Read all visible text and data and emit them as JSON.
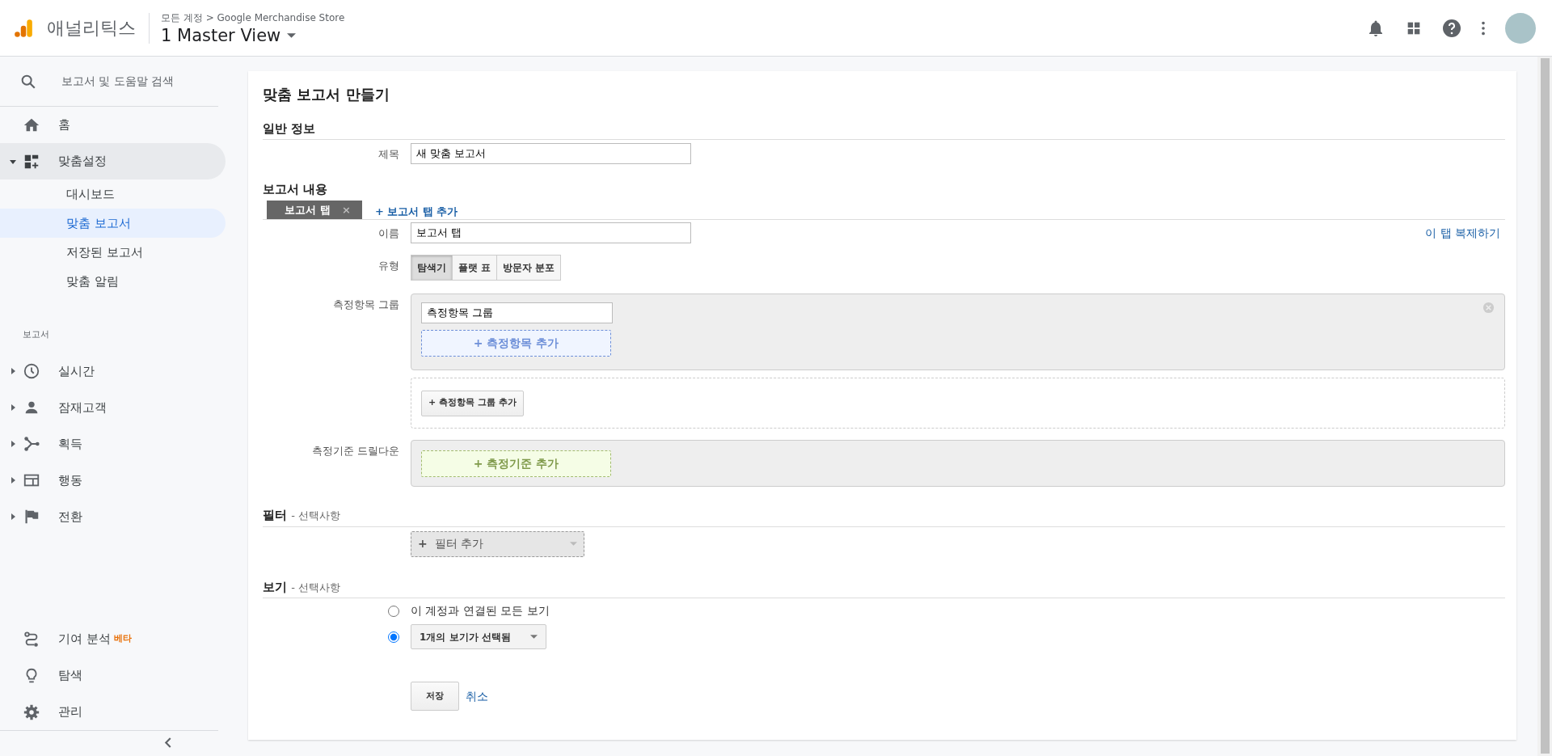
{
  "header": {
    "product": "애널리틱스",
    "breadcrumb": "모든 계정 > Google Merchandise Store",
    "view": "1 Master View"
  },
  "sidebar": {
    "search_placeholder": "보고서 및 도움말 검색",
    "top_items": [
      {
        "label": "홈",
        "selected": false
      },
      {
        "label": "맞춤설정",
        "selected": true,
        "expanded": true,
        "children": [
          {
            "label": "대시보드",
            "selected": false
          },
          {
            "label": "맞춤 보고서",
            "selected": true
          },
          {
            "label": "저장된 보고서",
            "selected": false
          },
          {
            "label": "맞춤 알림",
            "selected": false
          }
        ]
      }
    ],
    "section_label": "보고서",
    "report_items": [
      {
        "label": "실시간",
        "expanded": false
      },
      {
        "label": "잠재고객",
        "expanded": false
      },
      {
        "label": "획득",
        "expanded": false
      },
      {
        "label": "행동",
        "expanded": false
      },
      {
        "label": "전환",
        "expanded": false
      }
    ],
    "bottom_items": [
      {
        "label": "기여 분석",
        "badge": "베타"
      },
      {
        "label": "탐색"
      },
      {
        "label": "관리"
      }
    ]
  },
  "form": {
    "title": "맞춤 보고서 만들기",
    "general": {
      "heading": "일반 정보",
      "title_label": "제목",
      "title_value": "새 맞춤 보고서"
    },
    "content": {
      "heading": "보고서 내용",
      "tabs": [
        {
          "label": "보고서 탭",
          "close": "×",
          "selected": true
        }
      ],
      "add_tab": "+ 보고서 탭 추가",
      "duplicate": "이 탭 복제하기",
      "name_label": "이름",
      "name_value": "보고서 탭",
      "type_label": "유형",
      "types": [
        {
          "label": "탐색기",
          "selected": true
        },
        {
          "label": "플랫 표",
          "selected": false
        },
        {
          "label": "방문자 분포",
          "selected": false
        }
      ],
      "metric_group_label": "측정항목 그룹",
      "metric_groups": [
        {
          "name": "측정항목 그룹",
          "add_metric": "+ 측정항목 추가"
        }
      ],
      "add_metric_group": "+ 측정항목 그룹 추가",
      "dimension_label": "측정기준 드릴다운",
      "add_dimension": "+ 측정기준 추가"
    },
    "filter": {
      "heading": "필터",
      "note": "- 선택사항",
      "add_filter": "**+**  필터 추가"
    },
    "views": {
      "heading": "보기",
      "note": "- 선택사항",
      "options": [
        {
          "kind": "text",
          "label": "이 계정과 연결된 모든 보기",
          "selected": false
        },
        {
          "kind": "dropdown",
          "label": "1개의 보기가 선택됨",
          "selected": true
        }
      ]
    },
    "actions": {
      "save": "저장",
      "cancel": "취소"
    }
  }
}
